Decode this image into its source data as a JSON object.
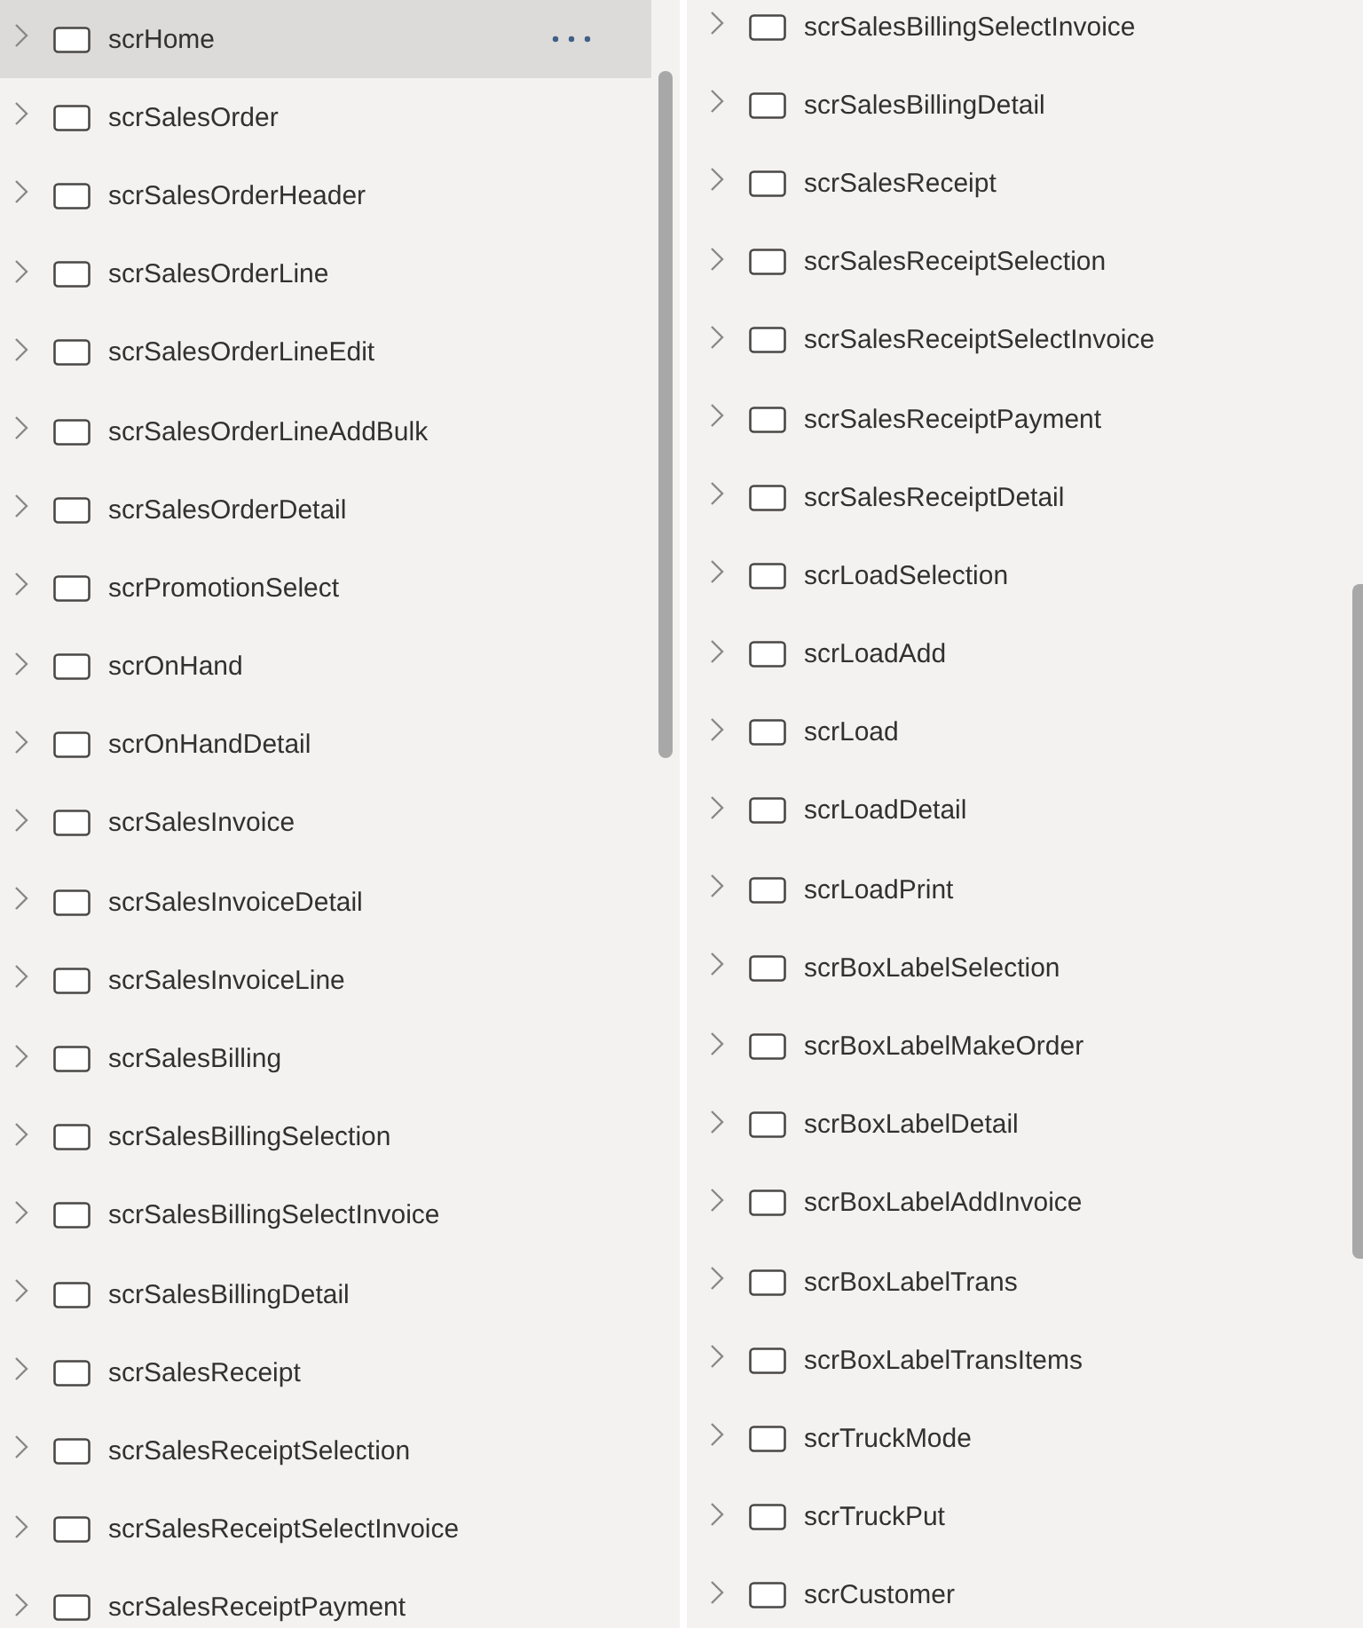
{
  "panels": [
    {
      "items": [
        {
          "label": "scrHome",
          "selected": true,
          "expanded": false
        },
        {
          "label": "scrSalesOrder",
          "selected": false,
          "expanded": false
        },
        {
          "label": "scrSalesOrderHeader",
          "selected": false,
          "expanded": false
        },
        {
          "label": "scrSalesOrderLine",
          "selected": false,
          "expanded": false
        },
        {
          "label": "scrSalesOrderLineEdit",
          "selected": false,
          "expanded": false
        },
        {
          "label": "scrSalesOrderLineAddBulk",
          "selected": false,
          "expanded": false
        },
        {
          "label": "scrSalesOrderDetail",
          "selected": false,
          "expanded": false
        },
        {
          "label": "scrPromotionSelect",
          "selected": false,
          "expanded": false
        },
        {
          "label": "scrOnHand",
          "selected": false,
          "expanded": false
        },
        {
          "label": "scrOnHandDetail",
          "selected": false,
          "expanded": false
        },
        {
          "label": "scrSalesInvoice",
          "selected": false,
          "expanded": false
        },
        {
          "label": "scrSalesInvoiceDetail",
          "selected": false,
          "expanded": false
        },
        {
          "label": "scrSalesInvoiceLine",
          "selected": false,
          "expanded": false
        },
        {
          "label": "scrSalesBilling",
          "selected": false,
          "expanded": false
        },
        {
          "label": "scrSalesBillingSelection",
          "selected": false,
          "expanded": false
        },
        {
          "label": "scrSalesBillingSelectInvoice",
          "selected": false,
          "expanded": false
        },
        {
          "label": "scrSalesBillingDetail",
          "selected": false,
          "expanded": false
        },
        {
          "label": "scrSalesReceipt",
          "selected": false,
          "expanded": false
        },
        {
          "label": "scrSalesReceiptSelection",
          "selected": false,
          "expanded": false
        },
        {
          "label": "scrSalesReceiptSelectInvoice",
          "selected": false,
          "expanded": false
        },
        {
          "label": "scrSalesReceiptPayment",
          "selected": false,
          "expanded": false
        }
      ]
    },
    {
      "items": [
        {
          "label": "scrSalesBillingSelectInvoice",
          "selected": false,
          "expanded": false
        },
        {
          "label": "scrSalesBillingDetail",
          "selected": false,
          "expanded": false
        },
        {
          "label": "scrSalesReceipt",
          "selected": false,
          "expanded": false
        },
        {
          "label": "scrSalesReceiptSelection",
          "selected": false,
          "expanded": false
        },
        {
          "label": "scrSalesReceiptSelectInvoice",
          "selected": false,
          "expanded": false
        },
        {
          "label": "scrSalesReceiptPayment",
          "selected": false,
          "expanded": false
        },
        {
          "label": "scrSalesReceiptDetail",
          "selected": false,
          "expanded": false
        },
        {
          "label": "scrLoadSelection",
          "selected": false,
          "expanded": false
        },
        {
          "label": "scrLoadAdd",
          "selected": false,
          "expanded": false
        },
        {
          "label": "scrLoad",
          "selected": false,
          "expanded": false
        },
        {
          "label": "scrLoadDetail",
          "selected": false,
          "expanded": false
        },
        {
          "label": "scrLoadPrint",
          "selected": false,
          "expanded": false
        },
        {
          "label": "scrBoxLabelSelection",
          "selected": false,
          "expanded": false
        },
        {
          "label": "scrBoxLabelMakeOrder",
          "selected": false,
          "expanded": false
        },
        {
          "label": "scrBoxLabelDetail",
          "selected": false,
          "expanded": false
        },
        {
          "label": "scrBoxLabelAddInvoice",
          "selected": false,
          "expanded": false
        },
        {
          "label": "scrBoxLabelTrans",
          "selected": false,
          "expanded": false
        },
        {
          "label": "scrBoxLabelTransItems",
          "selected": false,
          "expanded": false
        },
        {
          "label": "scrTruckMode",
          "selected": false,
          "expanded": false
        },
        {
          "label": "scrTruckPut",
          "selected": false,
          "expanded": false
        },
        {
          "label": "scrCustomer",
          "selected": false,
          "expanded": false
        }
      ]
    }
  ]
}
